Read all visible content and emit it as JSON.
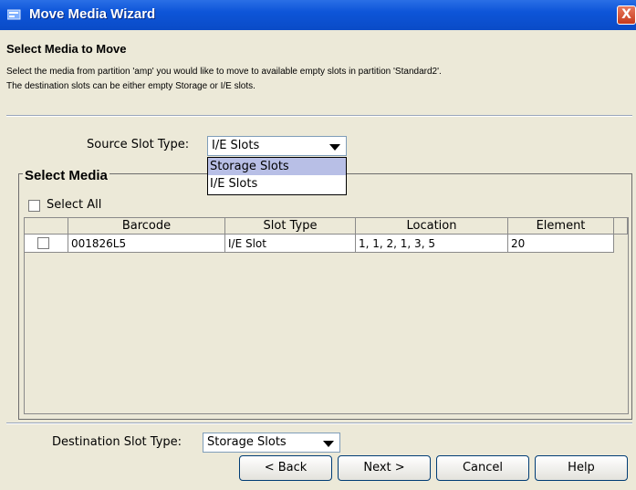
{
  "window": {
    "title": "Move Media Wizard",
    "close_glyph": "X"
  },
  "header": {
    "heading": "Select Media to Move",
    "description_line1": "Select the media from partition 'amp' you would like to move to available empty slots in partition 'Standard2'.",
    "description_line2": "The destination slots can be either empty Storage or I/E slots."
  },
  "source_slot": {
    "label": "Source Slot Type:",
    "selected": "I/E Slots",
    "options": [
      "Storage Slots",
      "I/E Slots"
    ],
    "highlighted_option": "Storage Slots"
  },
  "select_media": {
    "group_title": "Select Media",
    "select_all_label": "Select All",
    "select_all_checked": false,
    "columns": [
      "",
      "Barcode",
      "Slot Type",
      "Location",
      "Element"
    ],
    "rows": [
      {
        "checked": false,
        "barcode": "001826L5",
        "slot_type": "I/E Slot",
        "location": "1, 1, 2, 1, 3, 5",
        "element": "20"
      }
    ]
  },
  "destination_slot": {
    "label": "Destination Slot Type:",
    "selected": "Storage Slots"
  },
  "buttons": {
    "back": "< Back",
    "next": "Next >",
    "cancel": "Cancel",
    "help": "Help"
  },
  "colors": {
    "titlebar": "#0a4bc7",
    "dialog_bg": "#ece9d8",
    "dropdown_highlight": "#b8bfe6",
    "close_button": "#c63a1c"
  }
}
